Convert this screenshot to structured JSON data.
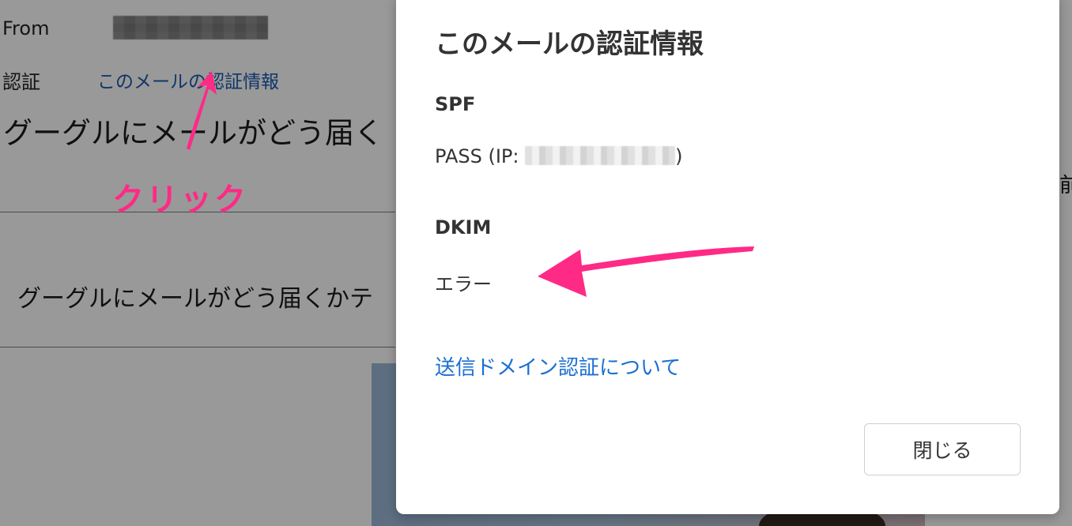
{
  "mail": {
    "from_label": "From",
    "auth_label": "認証",
    "auth_link": "このメールの認証情報",
    "subject": "グーグルにメールがどう届く",
    "body_preview": "グーグルにメールがどう届くかテ",
    "edge_text": "前"
  },
  "annotation": {
    "click_label": "クリック",
    "color": "#ff2a86"
  },
  "dialog": {
    "title": "このメールの認証情報",
    "spf": {
      "heading": "SPF",
      "value_prefix": "PASS (IP: ",
      "value_suffix": ")"
    },
    "dkim": {
      "heading": "DKIM",
      "value": "エラー"
    },
    "link": "送信ドメイン認証について",
    "close_button": "閉じる"
  },
  "colors": {
    "link_blue": "#1a6fd1",
    "annotation_pink": "#ff2a86",
    "overlay": "rgba(0,0,0,0.40)"
  }
}
